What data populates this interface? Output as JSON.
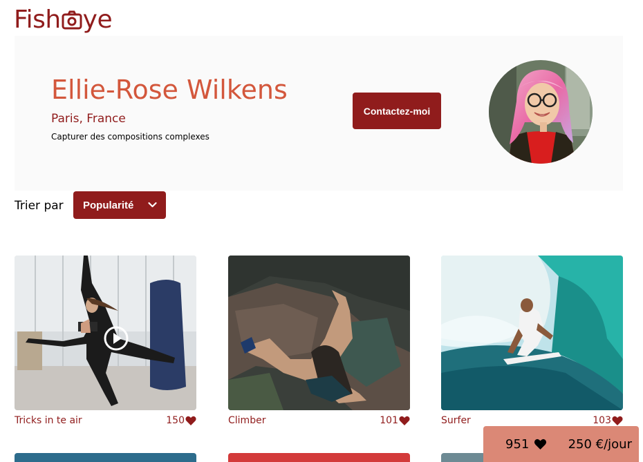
{
  "brand": {
    "logo_prefix": "Fish",
    "logo_suffix": "ye",
    "logo_icon": "camera-icon"
  },
  "photographer": {
    "name": "Ellie-Rose Wilkens",
    "location": "Paris, France",
    "tagline": "Capturer des compositions complexes",
    "contact_label": "Contactez-moi"
  },
  "sort": {
    "label": "Trier par",
    "selected": "Popularité"
  },
  "media": [
    {
      "title": "Tricks in te air",
      "likes": "150",
      "type": "video"
    },
    {
      "title": "Climber",
      "likes": "101",
      "type": "image"
    },
    {
      "title": "Surfer",
      "likes": "103",
      "type": "image"
    }
  ],
  "stats": {
    "total_likes": "951",
    "price": "250 €/jour"
  },
  "colors": {
    "primary": "#901C1C",
    "secondary": "#D3573C",
    "stats_bg": "#DB8876",
    "header_bg": "#FAFAFA"
  }
}
